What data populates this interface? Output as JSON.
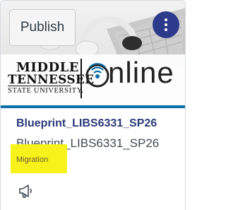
{
  "card": {
    "publish_label": "Publish",
    "course_title": "Blueprint_LIBS6331_SP26",
    "course_code": "Blueprint_LIBS6331_SP26",
    "term": "Migration",
    "logo": {
      "line1": "MIDDLE",
      "line2": "TENNESSEE",
      "line3": "STATE UNIVERSITY.",
      "online_text": "nline"
    },
    "icons": {
      "menu": "kebab-menu-icon",
      "announcements": "megaphone-icon"
    },
    "colors": {
      "accent_bar": "#0b6ea8",
      "title": "#2b3a7a",
      "menu_button": "#2b3a8a",
      "highlight": "#f7f21a"
    }
  }
}
